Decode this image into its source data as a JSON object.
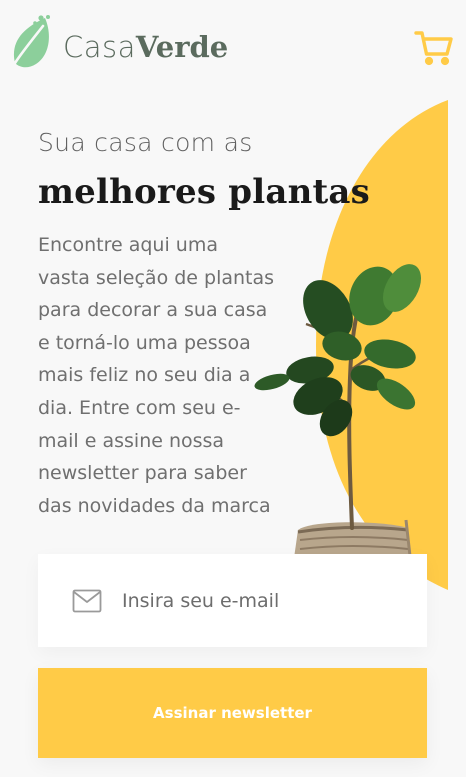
{
  "brand": {
    "name_light": "Casa",
    "name_bold": "Verde",
    "leaf_color": "#8ccf9b",
    "text_color": "#5b6b5e"
  },
  "header": {
    "cart_icon": "shopping-cart-icon",
    "cart_color": "#ffcb47"
  },
  "hero": {
    "subtitle": "Sua casa com as",
    "title": "melhores plantas",
    "description_lines": [
      "Encontre aqui uma",
      "vasta seleção de plantas",
      "para decorar a sua casa",
      "e torná-lo uma pessoa",
      "mais feliz no seu dia a",
      "dia. Entre com seu e-",
      "mail e assine nossa",
      "newsletter para saber",
      "das novidades da marca"
    ],
    "accent_color": "#ffcb47"
  },
  "newsletter": {
    "email_icon": "envelope-icon",
    "email_placeholder": "Insira seu e-mail",
    "email_value": "",
    "button_label": "Assinar newsletter"
  }
}
